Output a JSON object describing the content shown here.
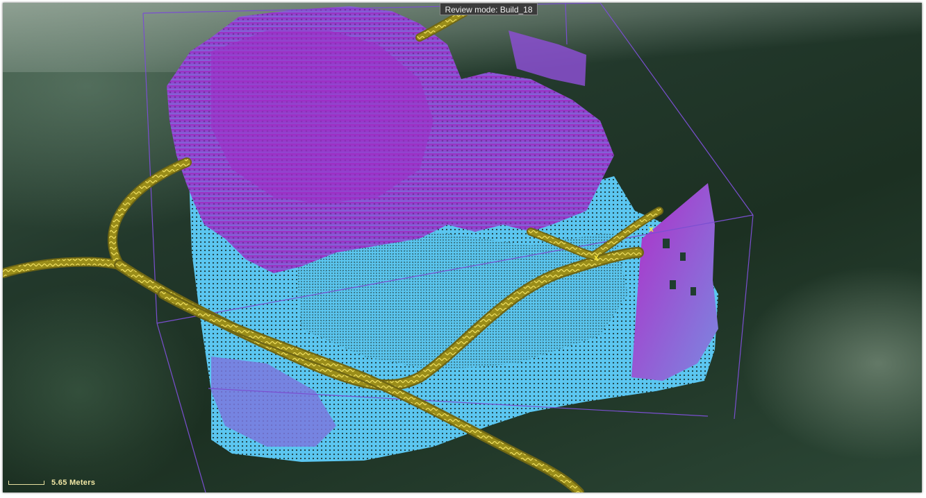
{
  "viewer": {
    "review_mode_label": "Review mode: Build_18",
    "scale_label": "5.65 Meters"
  },
  "markers": [
    {
      "label": "x"
    },
    {
      "label": "x"
    }
  ],
  "colors": {
    "vegetation_high": "#a02cc4",
    "vegetation_low": "#7f6bd6",
    "ground_points": "#5bc6f0",
    "trajectory": "#a99a1c",
    "bounding_box": "#7a4fd0",
    "background": "#22382b",
    "label_text": "#f3e9a6"
  },
  "icons": [
    "point-cloud",
    "trajectory-path",
    "bounding-box",
    "marker-x",
    "scale-bar"
  ]
}
